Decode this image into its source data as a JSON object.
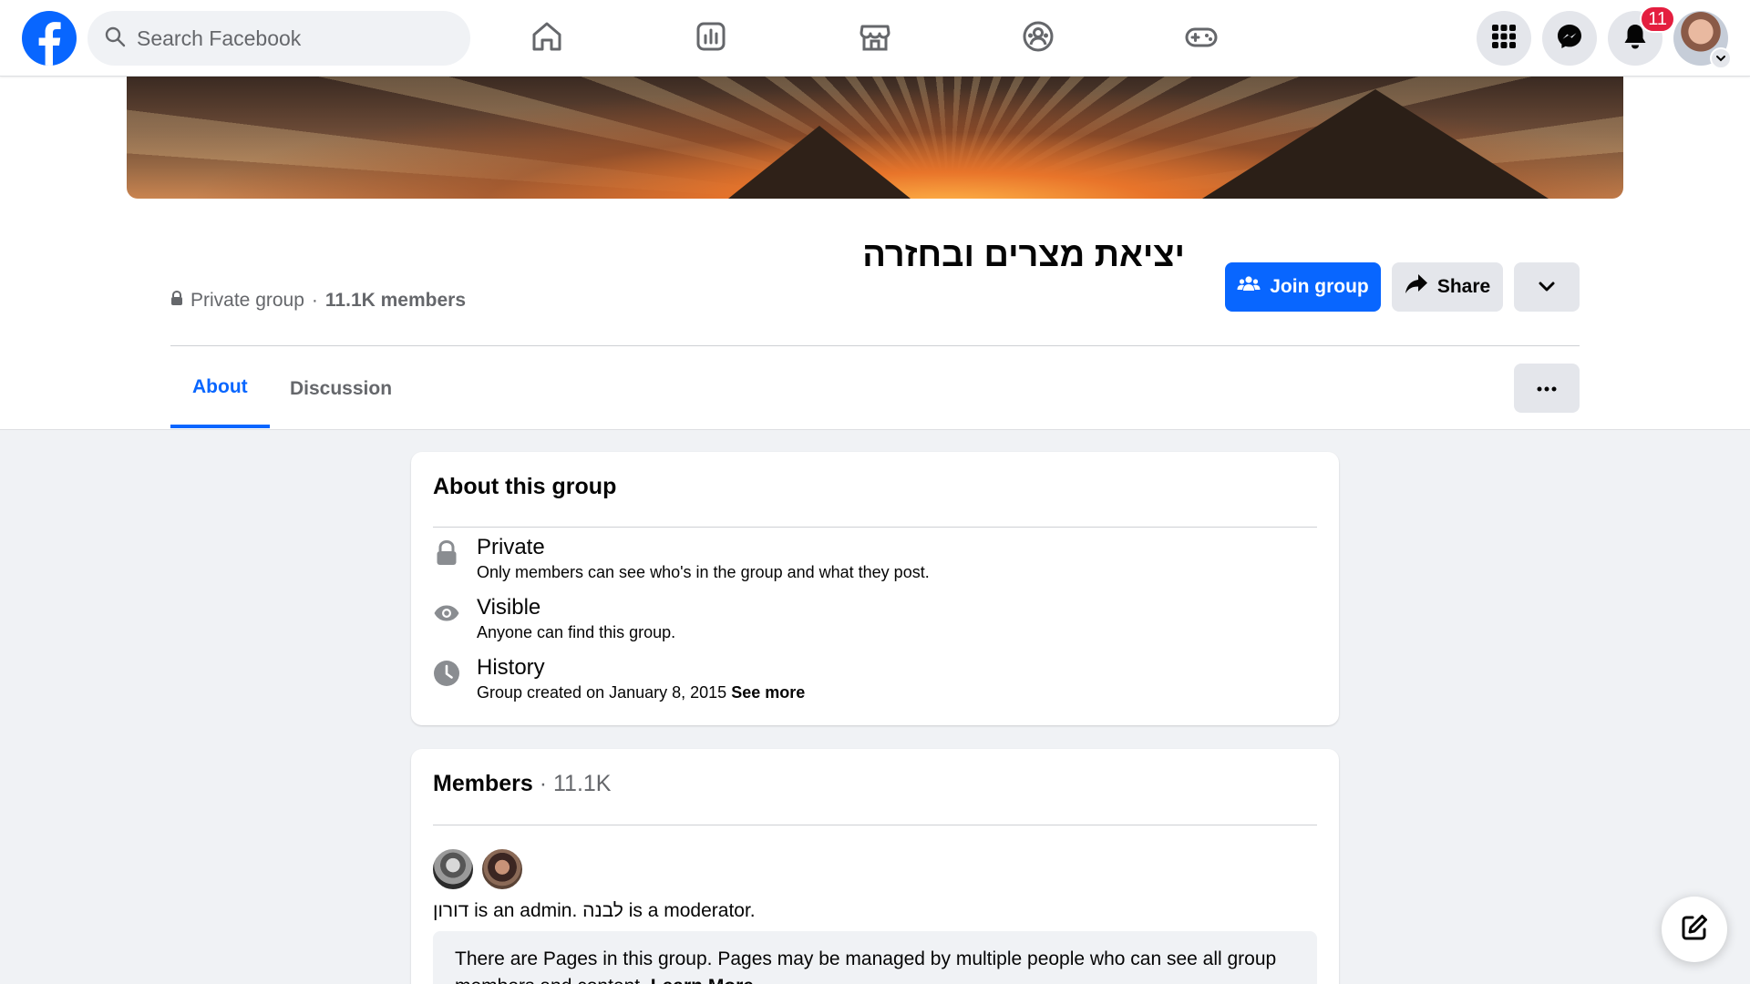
{
  "topnav": {
    "logo_icon": "facebook-logo",
    "search_placeholder": "Search Facebook",
    "tabs": [
      {
        "name": "home",
        "icon": "home-icon"
      },
      {
        "name": "feeds",
        "icon": "feeds-chart-icon"
      },
      {
        "name": "marketplace",
        "icon": "marketplace-store-icon"
      },
      {
        "name": "groups",
        "icon": "groups-icon"
      },
      {
        "name": "gaming",
        "icon": "gaming-controller-icon"
      }
    ],
    "menu_icon": "grid-menu-icon",
    "messenger_icon": "messenger-icon",
    "notifications_icon": "bell-icon",
    "notifications_count": "11"
  },
  "group": {
    "name": "יציאת מצרים ובחזרה",
    "privacy_label": "Private group",
    "separator": "·",
    "members_label": "11.1K members",
    "join_label": "Join group",
    "share_label": "Share"
  },
  "tabs": [
    {
      "label": "About",
      "active": true
    },
    {
      "label": "Discussion",
      "active": false
    }
  ],
  "about": {
    "title": "About this group",
    "items": [
      {
        "icon": "lock-icon",
        "title": "Private",
        "desc": "Only members can see who's in the group and what they post."
      },
      {
        "icon": "eye-icon",
        "title": "Visible",
        "desc": "Anyone can find this group."
      },
      {
        "icon": "clock-icon",
        "title": "History",
        "desc": "Group created on January 8, 2015",
        "link": "See more"
      }
    ]
  },
  "members": {
    "title": "Members",
    "count": "· 11.1K",
    "admin_name": "דורון",
    "admin_text": " is an admin. ",
    "moderator_name": "לבנה",
    "moderator_text": " is a moderator.",
    "pages_note": "There are Pages in this group. Pages may be managed by multiple people who can see all group members and content.",
    "learn_more": "Learn More"
  },
  "colors": {
    "brand_blue": "#0866ff",
    "badge_red": "#e41e3f",
    "background": "#f0f2f5"
  }
}
